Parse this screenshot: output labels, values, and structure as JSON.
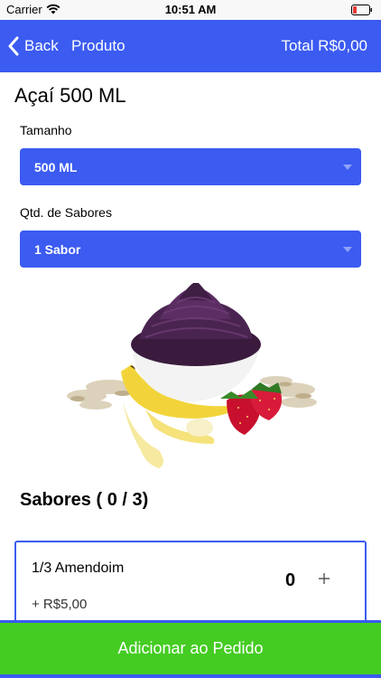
{
  "status_bar": {
    "carrier": "Carrier",
    "time": "10:51 AM"
  },
  "nav": {
    "back_label": "Back",
    "title": "Produto",
    "total": "Total R$0,00"
  },
  "product": {
    "title": "Açaí 500 ML"
  },
  "size": {
    "label": "Tamanho",
    "value": "500 ML"
  },
  "flavor_count": {
    "label": "Qtd. de Sabores",
    "value": "1 Sabor"
  },
  "flavors": {
    "title": "Sabores ( 0 / 3)",
    "items": [
      {
        "name": "1/3 Amendoim",
        "price": "+ R$5,00",
        "qty": "0"
      }
    ]
  },
  "add_button": {
    "label": "Adicionar ao Pedido"
  },
  "colors": {
    "primary": "#3b5bf1",
    "action": "#44cc22",
    "battery_low": "#e53935"
  }
}
